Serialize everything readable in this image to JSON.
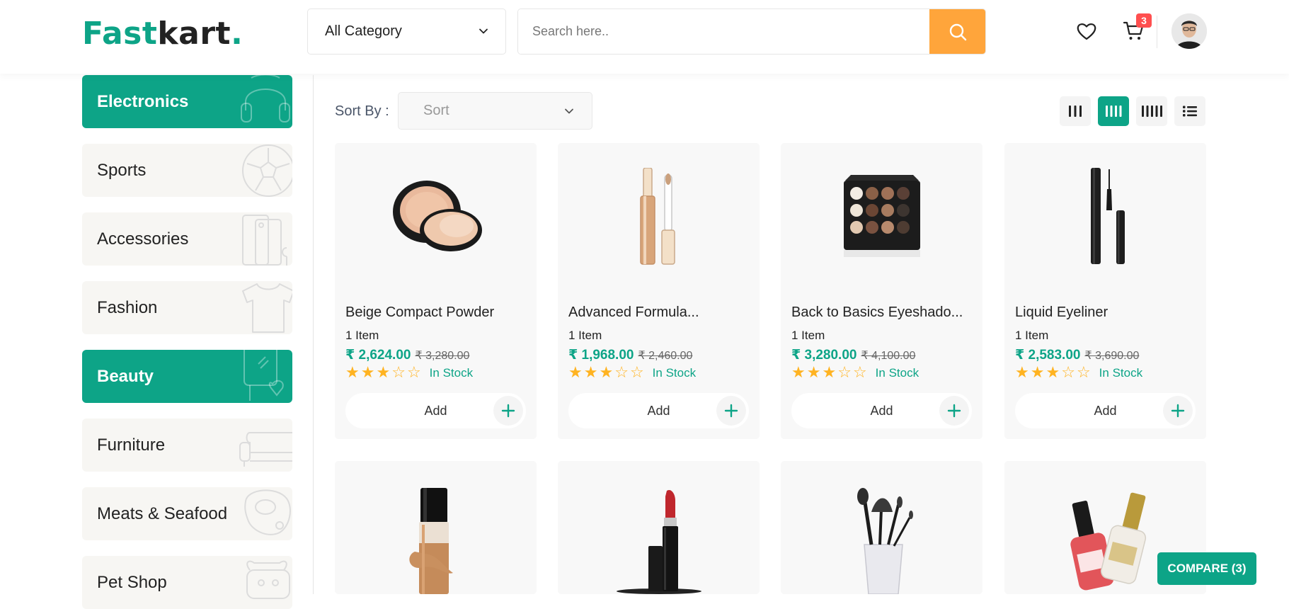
{
  "header": {
    "logo_part1": "Fast",
    "logo_part2": "kart",
    "logo_dot": ".",
    "category_select": "All Category",
    "search_placeholder": "Search here..",
    "cart_count": "3"
  },
  "sidebar": {
    "items": [
      {
        "label": "Electronics",
        "active": true,
        "icon": "headphones-icon"
      },
      {
        "label": "Sports",
        "active": false,
        "icon": "ball-icon"
      },
      {
        "label": "Accessories",
        "active": false,
        "icon": "phone-icon"
      },
      {
        "label": "Fashion",
        "active": false,
        "icon": "tshirt-icon"
      },
      {
        "label": "Beauty",
        "active": true,
        "icon": "mirror-icon"
      },
      {
        "label": "Furniture",
        "active": false,
        "icon": "sofa-icon"
      },
      {
        "label": "Meats & Seafood",
        "active": false,
        "icon": "meat-icon"
      },
      {
        "label": "Pet Shop",
        "active": false,
        "icon": "pet-icon"
      }
    ]
  },
  "toolbar": {
    "sort_label": "Sort By :",
    "sort_placeholder": "Sort"
  },
  "products": [
    {
      "name": "Beige Compact Powder",
      "qty": "1 Item",
      "price": "₹ 2,624.00",
      "old_price": "₹ 3,280.00",
      "rating": 3,
      "stock": "In Stock",
      "add": "Add"
    },
    {
      "name": "Advanced Formula...",
      "qty": "1 Item",
      "price": "₹ 1,968.00",
      "old_price": "₹ 2,460.00",
      "rating": 3,
      "stock": "In Stock",
      "add": "Add"
    },
    {
      "name": "Back to Basics Eyeshado...",
      "qty": "1 Item",
      "price": "₹ 3,280.00",
      "old_price": "₹ 4,100.00",
      "rating": 3,
      "stock": "In Stock",
      "add": "Add"
    },
    {
      "name": "Liquid Eyeliner",
      "qty": "1 Item",
      "price": "₹ 2,583.00",
      "old_price": "₹ 3,690.00",
      "rating": 3,
      "stock": "In Stock",
      "add": "Add"
    }
  ],
  "compare_label": "COMPARE (3)",
  "colors": {
    "accent": "#0da487",
    "search_button": "#ffa53b",
    "badge": "#ff4f4f",
    "star": "#ffb321"
  }
}
